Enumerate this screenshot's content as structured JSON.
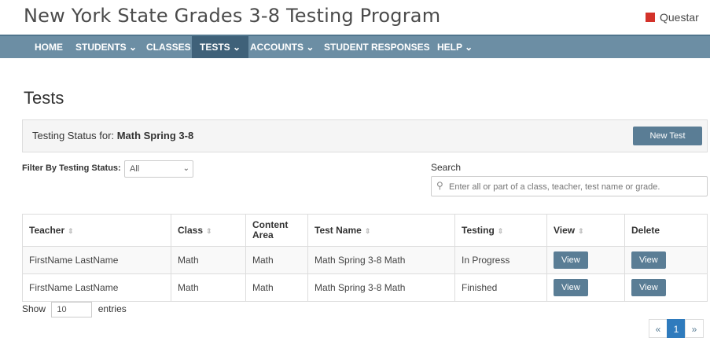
{
  "header": {
    "app_title": "New York State Grades 3-8 Testing Program",
    "brand_word": "Questar"
  },
  "nav": {
    "items": [
      {
        "label": "HOME"
      },
      {
        "label": "STUDENTS ⌄"
      },
      {
        "label": "CLASSES"
      },
      {
        "label": "TESTS ⌄"
      },
      {
        "label": "ACCOUNTS ⌄"
      },
      {
        "label": "STUDENT RESPONSES"
      },
      {
        "label": "HELP ⌄"
      }
    ]
  },
  "page": {
    "title": "Tests"
  },
  "status_panel": {
    "prefix": "Testing Status for:",
    "subject": "Math Spring 3-8",
    "new_test_label": "New Test"
  },
  "filter": {
    "label": "Filter By Testing Status:",
    "value": "All",
    "caret": "⌄"
  },
  "search": {
    "label": "Search",
    "placeholder": "Enter all or part of a class, teacher, test name or grade.",
    "icon": "search-icon"
  },
  "table": {
    "headers": [
      "Teacher",
      "Class",
      "Content Area",
      "Test Name",
      "Testing",
      "View",
      "Delete"
    ],
    "rows": [
      [
        "FirstName LastName",
        "Math",
        "Math",
        "Math Spring 3-8 Math",
        "In Progress",
        "View",
        "View"
      ],
      [
        "FirstName LastName",
        "Math",
        "Math",
        "Math Spring 3-8 Math",
        "Finished",
        "View",
        "View"
      ]
    ]
  },
  "length": {
    "show": "Show",
    "value": "10",
    "entries": "entries"
  },
  "pagination": {
    "prev": "«",
    "current": "1",
    "next": "»"
  }
}
